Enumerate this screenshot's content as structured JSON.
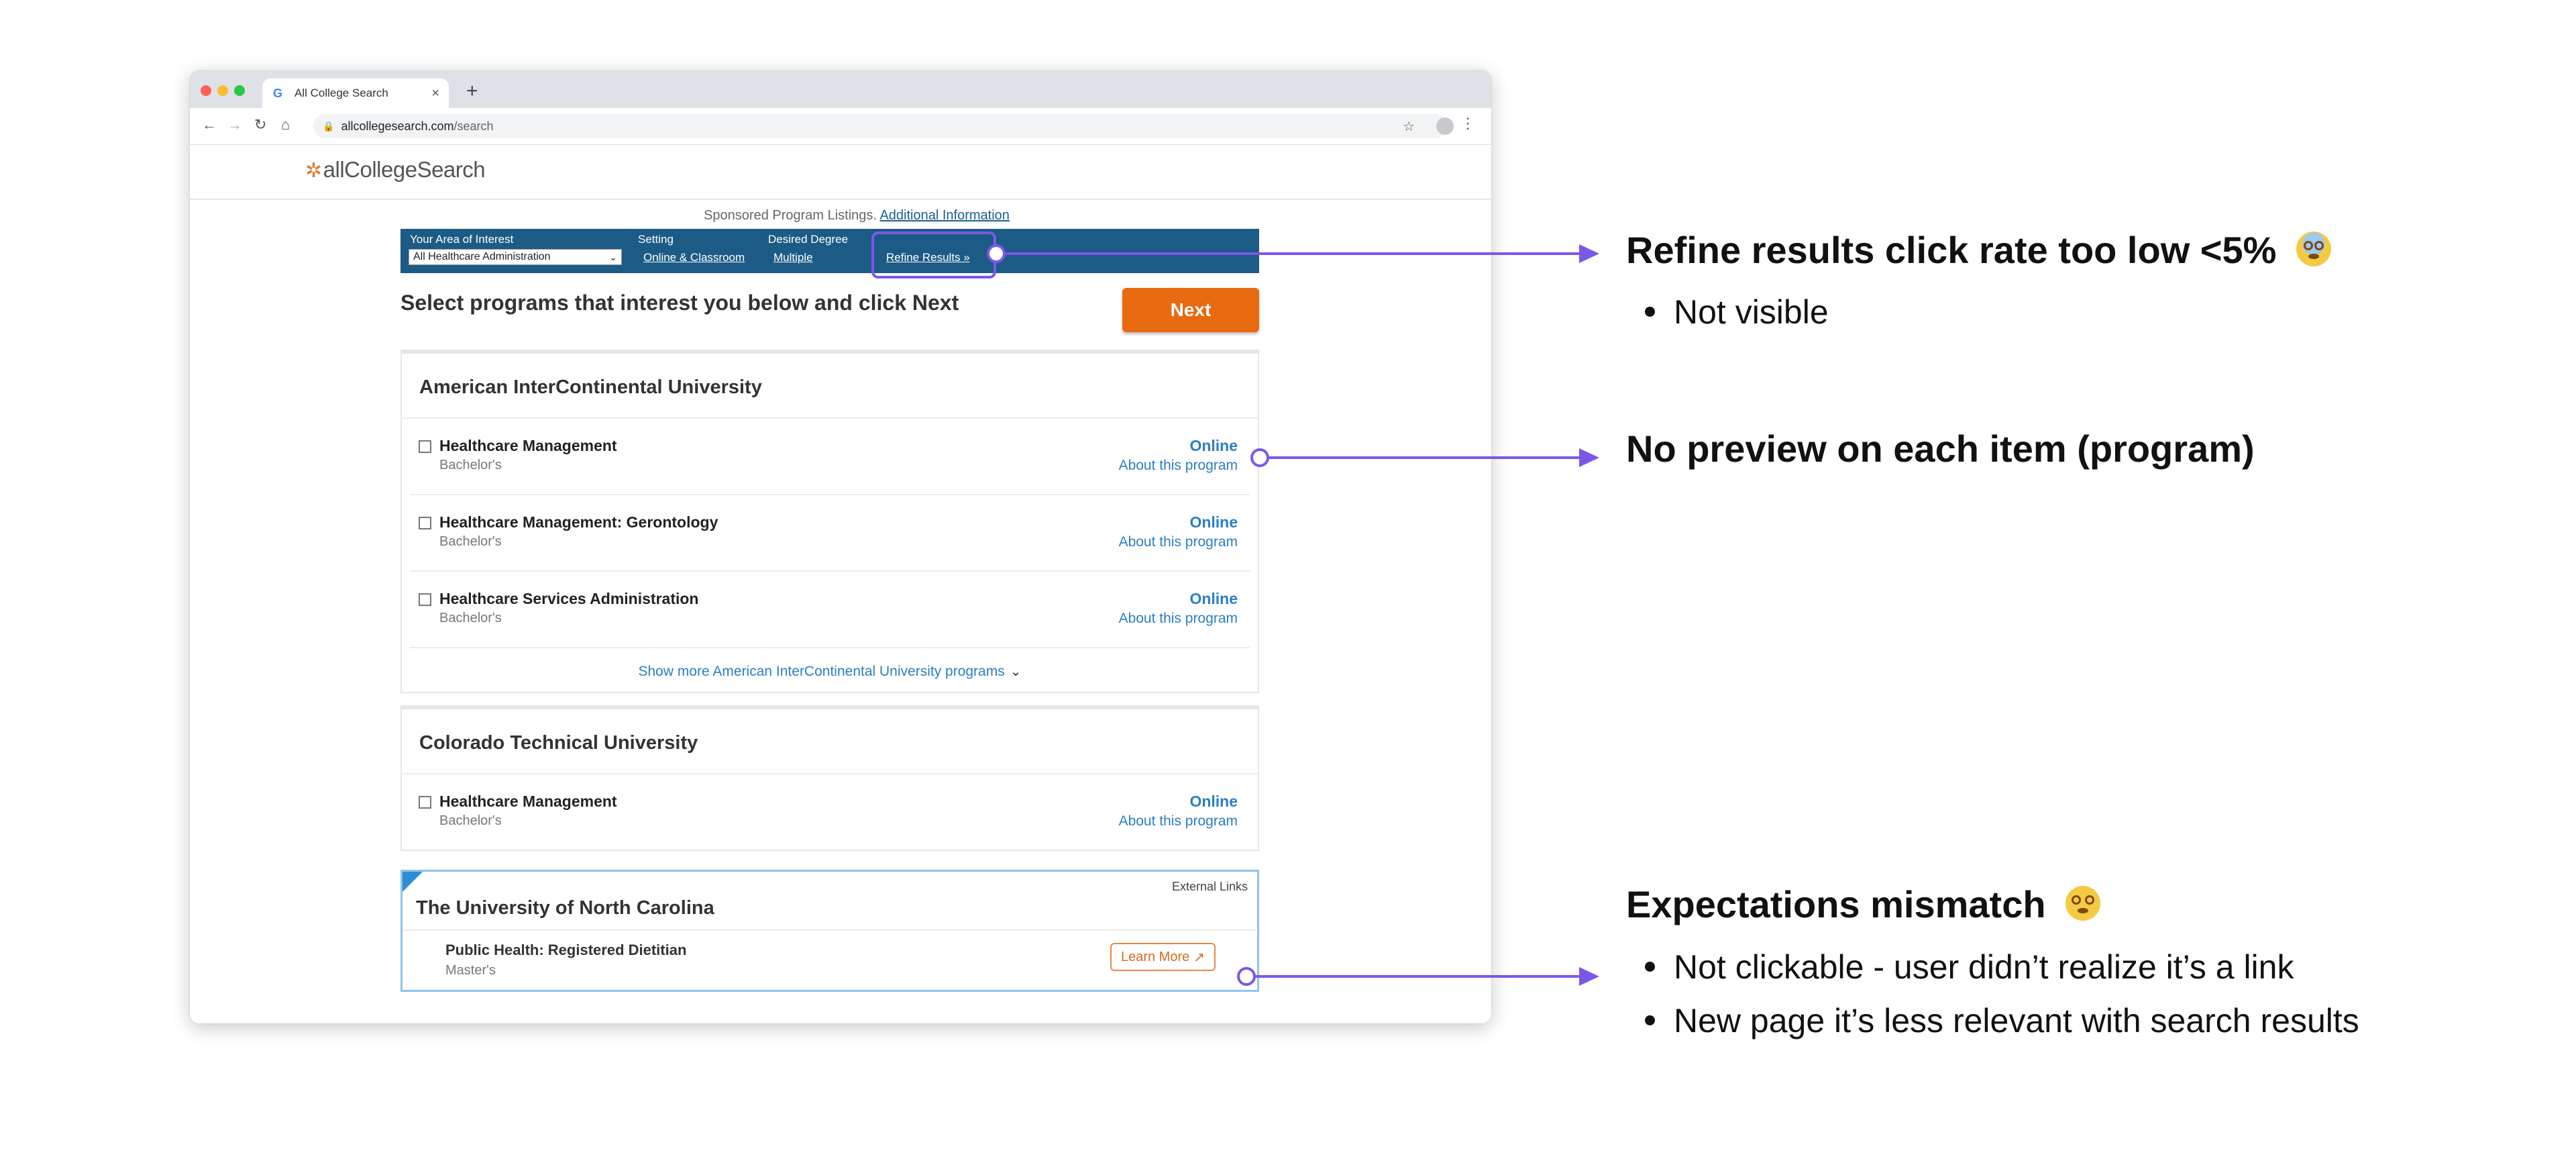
{
  "browser": {
    "tab_title": "All College Search",
    "tab_close": "×",
    "new_tab": "+",
    "url_host": "allcollegesearch.com",
    "url_path": "/search"
  },
  "site": {
    "logo": "allCollegeSearch",
    "sponsored_text": "Sponsored Program Listings.",
    "sponsored_link": "Additional Information",
    "filters": {
      "area_label": "Your Area of Interest",
      "area_value": "All Healthcare Administration",
      "setting_label": "Setting",
      "setting_value": "Online & Classroom",
      "degree_label": "Desired Degree",
      "degree_value": "Multiple",
      "refine_link": "Refine Results »"
    },
    "instruction": "Select programs that interest you below and click Next",
    "next_label": "Next",
    "schools": [
      {
        "name": "American InterContinental University",
        "programs": [
          {
            "name": "Healthcare Management",
            "degree": "Bachelor's",
            "mode": "Online",
            "about": "About this program"
          },
          {
            "name": "Healthcare Management: Gerontology",
            "degree": "Bachelor's",
            "mode": "Online",
            "about": "About this program"
          },
          {
            "name": "Healthcare Services Administration",
            "degree": "Bachelor's",
            "mode": "Online",
            "about": "About this program"
          }
        ],
        "show_more": "Show more American InterContinental University programs"
      },
      {
        "name": "Colorado Technical University",
        "programs": [
          {
            "name": "Healthcare Management",
            "degree": "Bachelor's",
            "mode": "Online",
            "about": "About this program"
          }
        ]
      }
    ],
    "external": {
      "label": "External Links",
      "school": "The University of North Carolina",
      "program": "Public Health: Registered Dietitian",
      "degree": "Master's",
      "button": "Learn More"
    }
  },
  "annotations": {
    "accent_color": "#7b57e8",
    "notes": [
      {
        "heading": "Refine results click rate too low <5%",
        "emoji": "fearful-face-emoji",
        "bullets": [
          "Not visible"
        ]
      },
      {
        "heading": "No preview on each item (program)",
        "bullets": []
      },
      {
        "heading": "Expectations mismatch",
        "emoji": "dizzy-face-emoji",
        "bullets": [
          "Not clickable - user didn’t realize it’s a link",
          "New page it’s less relevant with search results"
        ]
      }
    ]
  }
}
